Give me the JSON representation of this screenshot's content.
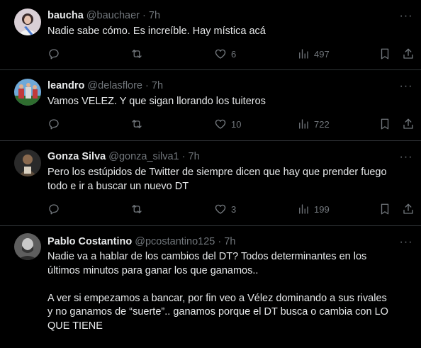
{
  "tweets": [
    {
      "name": "baucha",
      "handle": "@bauchaer",
      "time": "7h",
      "dot": "·",
      "text": [
        "Nadie sabe cómo. Es increíble. Hay mística acá"
      ],
      "likes": "6",
      "views": "497",
      "avatar_color": "#b9a7b9"
    },
    {
      "name": "leandro",
      "handle": "@delasflore",
      "time": "7h",
      "dot": "·",
      "text": [
        "Vamos VELEZ. Y que sigan llorando los tuiteros"
      ],
      "likes": "10",
      "views": "722",
      "avatar_color": "#4b8fc6"
    },
    {
      "name": "Gonza Silva",
      "handle": "@gonza_silva1",
      "time": "7h",
      "dot": "·",
      "text": [
        "Pero los estúpidos de Twitter de siempre dicen que hay que prender fuego todo e ir a buscar un nuevo DT"
      ],
      "likes": "3",
      "views": "199",
      "avatar_color": "#5a4a3a"
    },
    {
      "name": "Pablo Costantino",
      "handle": "@pcostantino125",
      "time": "7h",
      "dot": "·",
      "text": [
        "Nadie va a hablar de los cambios del DT? Todos determinantes en los últimos minutos para ganar los que ganamos..",
        "A ver si empezamos a bancar, por fin veo a Vélez dominando a sus rivales y no ganamos de “suerte”.. ganamos porque el DT busca o cambia con LO QUE TIENE"
      ],
      "avatar_color": "#6b6b6b"
    }
  ],
  "icons": {
    "reply": "reply-icon",
    "retweet": "retweet-icon",
    "like": "heart-icon",
    "views": "views-icon",
    "bookmark": "bookmark-icon",
    "share": "share-icon",
    "more": "more-icon"
  },
  "more_glyph": "···"
}
